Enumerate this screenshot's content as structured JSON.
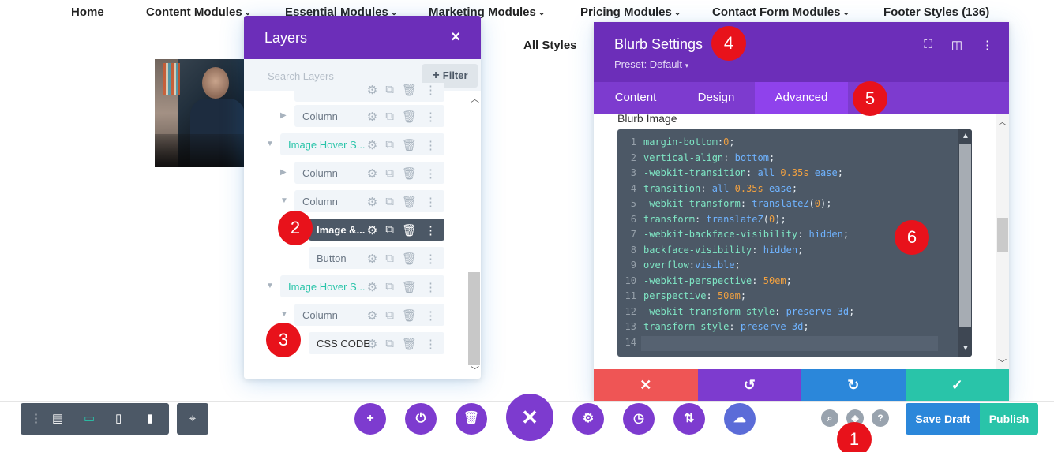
{
  "nav": {
    "items": [
      "Home",
      "Content Modules",
      "Essential Modules",
      "Marketing Modules",
      "Pricing Modules",
      "Contact Form Modules",
      "Footer Styles (136)"
    ],
    "all_styles": "All Styles"
  },
  "layers": {
    "title": "Layers",
    "close": "×",
    "search_placeholder": "Search Layers",
    "filter_label": "Filter",
    "rows": [
      {
        "label": "Column"
      },
      {
        "label": "Image Hover S..."
      },
      {
        "label": "Column"
      },
      {
        "label": "Column"
      },
      {
        "label": "Image &..."
      },
      {
        "label": "Button"
      },
      {
        "label": "Image Hover S..."
      },
      {
        "label": "Column"
      },
      {
        "label": "CSS CODE"
      }
    ]
  },
  "settings": {
    "title": "Blurb Settings",
    "preset": "Preset: Default",
    "tabs": [
      "Content",
      "Design",
      "Advanced"
    ],
    "active_tab": "Advanced",
    "section_label": "Blurb Image",
    "code_lines": [
      {
        "n": "1",
        "p": "margin-bottom",
        "v": "0",
        "t": "num"
      },
      {
        "n": "2",
        "p": "vertical-align",
        "v": "bottom",
        "t": "val"
      },
      {
        "n": "3",
        "p": "-webkit-transition",
        "v": "all 0.35s ease",
        "t": "mix"
      },
      {
        "n": "4",
        "p": "transition",
        "v": "all 0.35s ease",
        "t": "mix"
      },
      {
        "n": "5",
        "p": "-webkit-transform",
        "v": "translateZ(0)",
        "t": "fn"
      },
      {
        "n": "6",
        "p": "transform",
        "v": "translateZ(0)",
        "t": "fn"
      },
      {
        "n": "7",
        "p": "-webkit-backface-visibility",
        "v": "hidden",
        "t": "val"
      },
      {
        "n": "8",
        "p": "backface-visibility",
        "v": "hidden",
        "t": "val"
      },
      {
        "n": "9",
        "p": "overflow",
        "v": "visible",
        "t": "val"
      },
      {
        "n": "10",
        "p": "-webkit-perspective",
        "v": "50em",
        "t": "num"
      },
      {
        "n": "11",
        "p": "perspective",
        "v": "50em",
        "t": "num"
      },
      {
        "n": "12",
        "p": "-webkit-transform-style",
        "v": "preserve-3d",
        "t": "val"
      },
      {
        "n": "13",
        "p": "transform-style",
        "v": "preserve-3d",
        "t": "val"
      },
      {
        "n": "14",
        "p": "",
        "v": "",
        "t": "empty"
      }
    ],
    "footer": {
      "cancel": "✕",
      "undo": "↺",
      "redo": "↻",
      "save": "✓"
    }
  },
  "bottombar": {
    "save_draft": "Save Draft",
    "publish": "Publish"
  },
  "callouts": [
    "1",
    "2",
    "3",
    "4",
    "5",
    "6"
  ],
  "colors": {
    "purple": "#6c2eb9",
    "tab_purple": "#7d3bcf",
    "teal": "#29c4a9",
    "blue": "#2b87da",
    "red": "#ef5555",
    "slate": "#4c5866",
    "callout_red": "#e8121b"
  }
}
